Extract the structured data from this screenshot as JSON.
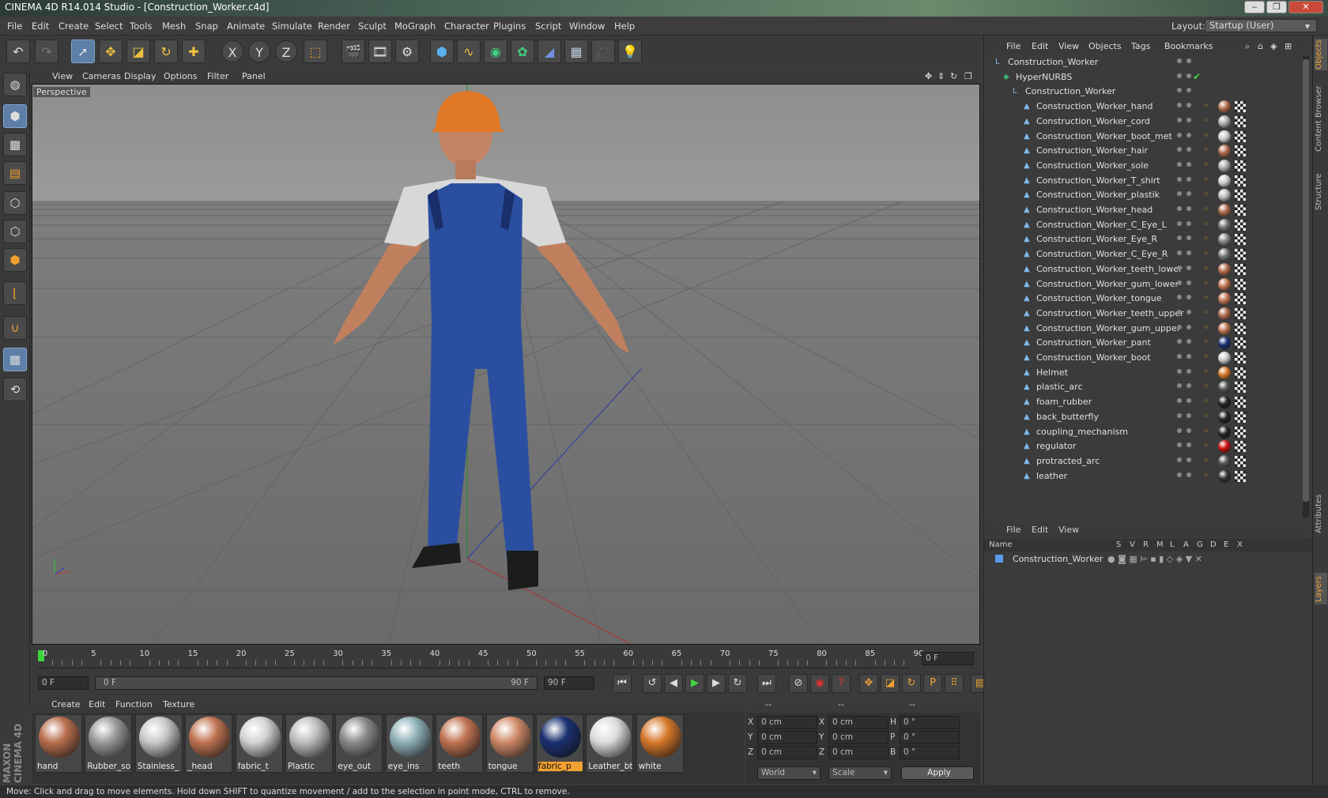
{
  "titlebar": {
    "title": "CINEMA 4D R14.014 Studio - [Construction_Worker.c4d]",
    "min": "‒",
    "max": "❐",
    "close": "✕"
  },
  "menubar": {
    "items": [
      "File",
      "Edit",
      "Create",
      "Select",
      "Tools",
      "Mesh",
      "Snap",
      "Animate",
      "Simulate",
      "Render",
      "Sculpt",
      "MoGraph",
      "Character",
      "Plugins",
      "Script",
      "Window",
      "Help"
    ],
    "layout_label": "Layout:",
    "layout_value": "Startup (User)"
  },
  "toolbar": {
    "undo": "undo-icon",
    "redo": "redo-icon",
    "x_axis": "X",
    "y_axis": "Y",
    "z_axis": "Z"
  },
  "viewport": {
    "menu": [
      "View",
      "Cameras",
      "Display",
      "Options",
      "Filter",
      "Panel"
    ],
    "label": "Perspective"
  },
  "timeline": {
    "ticks": [
      "0",
      "5",
      "10",
      "15",
      "20",
      "25",
      "30",
      "35",
      "40",
      "45",
      "50",
      "55",
      "60",
      "65",
      "70",
      "75",
      "80",
      "85",
      "90"
    ],
    "current_frame": "0 F",
    "start_field": "0 F",
    "range_start": "0 F",
    "range_end": "90 F",
    "end_field": "90 F"
  },
  "materials": {
    "menu": [
      "Create",
      "Edit",
      "Function",
      "Texture"
    ],
    "items": [
      {
        "label": "hand",
        "color": "#b86e4e"
      },
      {
        "label": "Rubber_so",
        "color": "#9a9a9a"
      },
      {
        "label": "Stainless_",
        "color": "#c8c8c8"
      },
      {
        "label": "_head",
        "color": "#c07452"
      },
      {
        "label": "fabric_t",
        "color": "#d2d2d2"
      },
      {
        "label": "Plastic",
        "color": "#bdbdbd"
      },
      {
        "label": "eye_out",
        "color": "#8a8a8a"
      },
      {
        "label": "eye_ins",
        "color": "#8fb0b8"
      },
      {
        "label": "teeth",
        "color": "#c07452"
      },
      {
        "label": "tongue",
        "color": "#d08a68"
      },
      {
        "label": "fabric_p",
        "color": "#1a3070"
      },
      {
        "label": "Leather_bt",
        "color": "#dcdcdc"
      },
      {
        "label": "white",
        "color": "#d6782a"
      }
    ],
    "selected": "fabric_p",
    "brand": "MAXON CINEMA 4D"
  },
  "coords": {
    "headers": [
      "--",
      "--",
      "--"
    ],
    "rows": [
      {
        "a": "X",
        "av": "0 cm",
        "b": "X",
        "bv": "0 cm",
        "c": "H",
        "cv": "0 °"
      },
      {
        "a": "Y",
        "av": "0 cm",
        "b": "Y",
        "bv": "0 cm",
        "c": "P",
        "cv": "0 °"
      },
      {
        "a": "Z",
        "av": "0 cm",
        "b": "Z",
        "bv": "0 cm",
        "c": "B",
        "cv": "0 °"
      }
    ],
    "space": "World",
    "mode": "Scale",
    "apply": "Apply"
  },
  "objects": {
    "menu": [
      "File",
      "Edit",
      "View",
      "Objects",
      "Tags",
      "Bookmarks"
    ],
    "tree": [
      {
        "name": "Construction_Worker",
        "level": 0,
        "t1": ""
      },
      {
        "name": "HyperNURBS",
        "level": 1,
        "t1": ""
      },
      {
        "name": "Construction_Worker",
        "level": 2,
        "t1": ""
      },
      {
        "name": "Construction_Worker_hand",
        "level": 3,
        "t1": "#b06a4c"
      },
      {
        "name": "Construction_Worker_cord",
        "level": 3,
        "t1": "#aaaaaa"
      },
      {
        "name": "Construction_Worker_boot_met",
        "level": 3,
        "t1": "#cccccc"
      },
      {
        "name": "Construction_Worker_hair",
        "level": 3,
        "t1": "#b06a4c"
      },
      {
        "name": "Construction_Worker_sole",
        "level": 3,
        "t1": "#aaaaaa"
      },
      {
        "name": "Construction_Worker_T_shirt",
        "level": 3,
        "t1": "#cccccc"
      },
      {
        "name": "Construction_Worker_plastik",
        "level": 3,
        "t1": "#bbbbbb"
      },
      {
        "name": "Construction_Worker_head",
        "level": 3,
        "t1": "#b06a4c"
      },
      {
        "name": "Construction_Worker_C_Eye_L",
        "level": 3,
        "t1": "#777777"
      },
      {
        "name": "Construction_Worker_Eye_R",
        "level": 3,
        "t1": "#888888"
      },
      {
        "name": "Construction_Worker_C_Eye_R",
        "level": 3,
        "t1": "#777777"
      },
      {
        "name": "Construction_Worker_teeth_lower",
        "level": 3,
        "t1": "#b06a4c"
      },
      {
        "name": "Construction_Worker_gum_lower",
        "level": 3,
        "t1": "#c07452"
      },
      {
        "name": "Construction_Worker_tongue",
        "level": 3,
        "t1": "#c07452"
      },
      {
        "name": "Construction_Worker_teeth_upper",
        "level": 3,
        "t1": "#b06a4c"
      },
      {
        "name": "Construction_Worker_gum_upper",
        "level": 3,
        "t1": "#c07452"
      },
      {
        "name": "Construction_Worker_pant",
        "level": 3,
        "t1": "#1a3070"
      },
      {
        "name": "Construction_Worker_boot",
        "level": 3,
        "t1": "#cccccc"
      },
      {
        "name": "Helmet",
        "level": 3,
        "t1": "#d6782a"
      },
      {
        "name": "plastic_arc",
        "level": 3,
        "t1": "#555555"
      },
      {
        "name": "foam_rubber",
        "level": 3,
        "t1": "#222222"
      },
      {
        "name": "back_butterfly",
        "level": 3,
        "t1": "#222222"
      },
      {
        "name": "coupling_mechanism",
        "level": 3,
        "t1": "#222222"
      },
      {
        "name": "regulator",
        "level": 3,
        "t1": "#cc1111"
      },
      {
        "name": "protracted_arc",
        "level": 3,
        "t1": "#555555"
      },
      {
        "name": "leather",
        "level": 3,
        "t1": "#333333"
      }
    ]
  },
  "layers": {
    "menu": [
      "File",
      "Edit",
      "View"
    ],
    "cols": [
      "Name",
      "S",
      "V",
      "R",
      "M",
      "L",
      "A",
      "G",
      "D",
      "E",
      "X"
    ],
    "row": "Construction_Worker"
  },
  "righttabs": [
    "Objects",
    "Content Browser",
    "Structure",
    "Attributes",
    "Layers"
  ],
  "status": "Move: Click and drag to move elements. Hold down SHIFT to quantize movement / add to the selection in point mode, CTRL to remove."
}
